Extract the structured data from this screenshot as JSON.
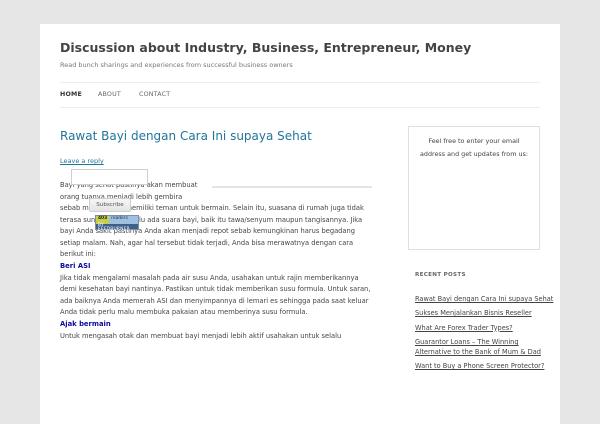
{
  "site": {
    "title": "Discussion about Industry, Business, Entrepreneur, Money",
    "description": "Read bunch sharings and experiences from successful business owners"
  },
  "nav": {
    "items": [
      {
        "label": "HOME"
      },
      {
        "label": "ABOUT"
      },
      {
        "label": "CONTACT"
      }
    ]
  },
  "post": {
    "title": "Rawat Bayi dengan Cara Ini supaya Sehat",
    "leave_reply": "Leave a reply",
    "intro_line1": "Bayi yang sehat pastinya akan membuat",
    "intro_line2": "orang tuanya menjadi lebih gembira",
    "intro_cont": "sebab mereka bisa memiliki teman untuk bermain. Selain itu, suasana di rumah juga tidak terasa sunyi sebab selalu ada suara bayi, baik itu tawa/senyum maupun tangisannya. Jika bayi Anda sakit pastinya Anda akan menjadi repot sebab kemungkinan harus begadang setiap malam. Nah, agar hal tersebut tidak terjadi, Anda bisa merawatnya dengan cara berikut ini:",
    "section1_title": "Beri ASI",
    "section1_text": "Jika tidak mengalami masalah pada air susu Anda, usahakan untuk rajin memberikannya demi kesehatan bayi nantinya. Pastikan untuk tidak memberikan susu formula. Untuk saran, ada baiknya Anda memerah ASI dan menyimpannya di lemari es sehingga pada saat keluar Anda tidak perlu malu membuka pakaian atau memberinya susu formula.",
    "section2_title": "Ajak bermain",
    "section2_text": "Untuk mengasah otak dan membuat bayi menjadi lebih aktif usahakan untuk selalu"
  },
  "sidebar": {
    "subscribe_text": "Feel free to enter your email address and get updates from us:",
    "email_value": "",
    "subscribe_label": "Subscribe",
    "feed_count": "403",
    "feed_label": "readers",
    "feed_by": "BY FEEDBURNER",
    "recent_title": "RECENT POSTS",
    "recent_posts": [
      {
        "label": "Rawat Bayi dengan Cara Ini supaya Sehat"
      },
      {
        "label": "Sukses Menjalankan Bisnis Reseller"
      },
      {
        "label": "What Are Forex Trader Types?"
      },
      {
        "label": "Guarantor Loans – The Winning Alternative to the Bank of Mum & Dad"
      },
      {
        "label": "Want to Buy a Phone Screen Protector?"
      }
    ]
  },
  "colors": {
    "link": "#21759b",
    "subheading": "#0b0b9c",
    "background": "#e6e6e6"
  }
}
